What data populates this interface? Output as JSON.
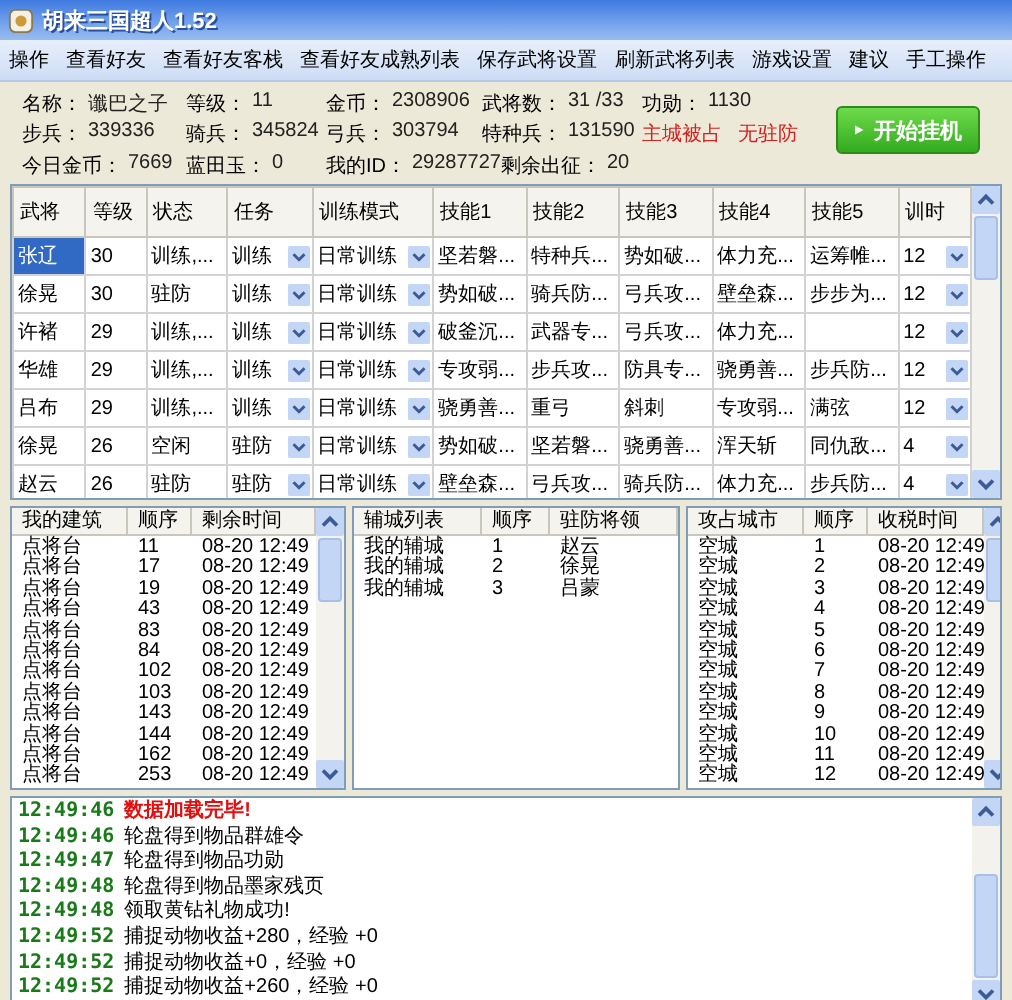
{
  "window": {
    "title": "胡来三国超人1.52"
  },
  "menu": [
    "操作",
    "查看好友",
    "查看好友客栈",
    "查看好友成熟列表",
    "保存武将设置",
    "刷新武将列表",
    "游戏设置",
    "建议",
    "手工操作"
  ],
  "info_rows": [
    [
      {
        "kind": "field",
        "label": "名称：",
        "value": "谶巴之子"
      },
      {
        "kind": "field",
        "label": "等级：",
        "value": "11"
      },
      {
        "kind": "field",
        "label": "金币：",
        "value": "2308906"
      },
      {
        "kind": "field",
        "label": "武将数：",
        "value": "31 /33"
      },
      {
        "kind": "field",
        "label": "功勋：",
        "value": "1130"
      }
    ],
    [
      {
        "kind": "field",
        "label": "步兵：",
        "value": "339336"
      },
      {
        "kind": "field",
        "label": "骑兵：",
        "value": "345824"
      },
      {
        "kind": "field",
        "label": "弓兵：",
        "value": "303794"
      },
      {
        "kind": "field",
        "label": "特种兵：",
        "value": "131590"
      },
      {
        "kind": "alert",
        "text": "主城被占"
      },
      {
        "kind": "alert",
        "text": "无驻防"
      }
    ],
    [
      {
        "kind": "field",
        "label": "今日金币：",
        "value": "7669"
      },
      {
        "kind": "field",
        "label": "蓝田玉：",
        "value": "0"
      },
      {
        "kind": "field",
        "label": "我的ID：",
        "value": "29287727"
      },
      {
        "kind": "field",
        "label": "剩余出征：",
        "value": "20"
      }
    ]
  ],
  "start_button": {
    "label": "开始挂机"
  },
  "generals_table": {
    "columns": [
      "武将",
      "等级",
      "状态",
      "任务",
      "训练模式",
      "技能1",
      "技能2",
      "技能3",
      "技能4",
      "技能5",
      "训时"
    ],
    "rows": [
      {
        "name": "张辽",
        "grade": "30",
        "status": "训练,...",
        "task": "训练",
        "mode": "日常训练",
        "skills": [
          "坚若磐...",
          "特种兵...",
          "势如破...",
          "体力充...",
          "运筹帷..."
        ],
        "hours": "12",
        "selected": true
      },
      {
        "name": "徐晃",
        "grade": "30",
        "status": "驻防",
        "task": "训练",
        "mode": "日常训练",
        "skills": [
          "势如破...",
          "骑兵防...",
          "弓兵攻...",
          "壁垒森...",
          "步步为..."
        ],
        "hours": "12",
        "selected": false
      },
      {
        "name": "许褚",
        "grade": "29",
        "status": "训练,...",
        "task": "训练",
        "mode": "日常训练",
        "skills": [
          "破釜沉...",
          "武器专...",
          "弓兵攻...",
          "体力充..."
        ],
        "hours": "12",
        "selected": false
      },
      {
        "name": "华雄",
        "grade": "29",
        "status": "训练,...",
        "task": "训练",
        "mode": "日常训练",
        "skills": [
          "专攻弱...",
          "步兵攻...",
          "防具专...",
          "骁勇善...",
          "步兵防..."
        ],
        "hours": "12",
        "selected": false
      },
      {
        "name": "吕布",
        "grade": "29",
        "status": "训练,...",
        "task": "训练",
        "mode": "日常训练",
        "skills": [
          "骁勇善...",
          "重弓",
          "斜刺",
          "专攻弱...",
          "满弦"
        ],
        "hours": "12",
        "selected": false
      },
      {
        "name": "徐晃",
        "grade": "26",
        "status": "空闲",
        "task": "驻防",
        "mode": "日常训练",
        "skills": [
          "势如破...",
          "坚若磐...",
          "骁勇善...",
          "浑天斩",
          "同仇敌..."
        ],
        "hours": "4",
        "selected": false
      },
      {
        "name": "赵云",
        "grade": "26",
        "status": "驻防",
        "task": "驻防",
        "mode": "日常训练",
        "skills": [
          "壁垒森...",
          "弓兵攻...",
          "骑兵防...",
          "体力充...",
          "步兵防..."
        ],
        "hours": "4",
        "selected": false
      }
    ]
  },
  "buildings": {
    "columns": [
      "我的建筑",
      "顺序",
      "剩余时间"
    ],
    "rows": [
      [
        "点将台",
        "11",
        "08-20 12:49"
      ],
      [
        "点将台",
        "17",
        "08-20 12:49"
      ],
      [
        "点将台",
        "19",
        "08-20 12:49"
      ],
      [
        "点将台",
        "43",
        "08-20 12:49"
      ],
      [
        "点将台",
        "83",
        "08-20 12:49"
      ],
      [
        "点将台",
        "84",
        "08-20 12:49"
      ],
      [
        "点将台",
        "102",
        "08-20 12:49"
      ],
      [
        "点将台",
        "103",
        "08-20 12:49"
      ],
      [
        "点将台",
        "143",
        "08-20 12:49"
      ],
      [
        "点将台",
        "144",
        "08-20 12:49"
      ],
      [
        "点将台",
        "162",
        "08-20 12:49"
      ],
      [
        "点将台",
        "253",
        "08-20 12:49"
      ]
    ]
  },
  "sub_cities": {
    "columns": [
      "辅城列表",
      "顺序",
      "驻防将领"
    ],
    "rows": [
      [
        "我的辅城",
        "1",
        "赵云"
      ],
      [
        "我的辅城",
        "2",
        "徐晃"
      ],
      [
        "我的辅城",
        "3",
        "吕蒙"
      ]
    ]
  },
  "captured_cities": {
    "columns": [
      "攻占城市",
      "顺序",
      "收税时间"
    ],
    "rows": [
      [
        "空城",
        "1",
        "08-20 12:49"
      ],
      [
        "空城",
        "2",
        "08-20 12:49"
      ],
      [
        "空城",
        "3",
        "08-20 12:49"
      ],
      [
        "空城",
        "4",
        "08-20 12:49"
      ],
      [
        "空城",
        "5",
        "08-20 12:49"
      ],
      [
        "空城",
        "6",
        "08-20 12:49"
      ],
      [
        "空城",
        "7",
        "08-20 12:49"
      ],
      [
        "空城",
        "8",
        "08-20 12:49"
      ],
      [
        "空城",
        "9",
        "08-20 12:49"
      ],
      [
        "空城",
        "10",
        "08-20 12:49"
      ],
      [
        "空城",
        "11",
        "08-20 12:49"
      ],
      [
        "空城",
        "12",
        "08-20 12:49"
      ]
    ]
  },
  "log": [
    {
      "time": "12:49:46",
      "text": "数据加载完毕!",
      "kind": "alert"
    },
    {
      "time": "12:49:46",
      "text": "轮盘得到物品群雄令",
      "kind": "info"
    },
    {
      "time": "12:49:47",
      "text": "轮盘得到物品功勋",
      "kind": "info"
    },
    {
      "time": "12:49:48",
      "text": "轮盘得到物品墨家残页",
      "kind": "info"
    },
    {
      "time": "12:49:48",
      "text": "领取黄钻礼物成功!",
      "kind": "info"
    },
    {
      "time": "12:49:52",
      "text": "捕捉动物收益+280，经验 +0",
      "kind": "info"
    },
    {
      "time": "12:49:52",
      "text": "捕捉动物收益+0，经验 +0",
      "kind": "info"
    },
    {
      "time": "12:49:52",
      "text": "捕捉动物收益+260，经验 +0",
      "kind": "info"
    }
  ]
}
